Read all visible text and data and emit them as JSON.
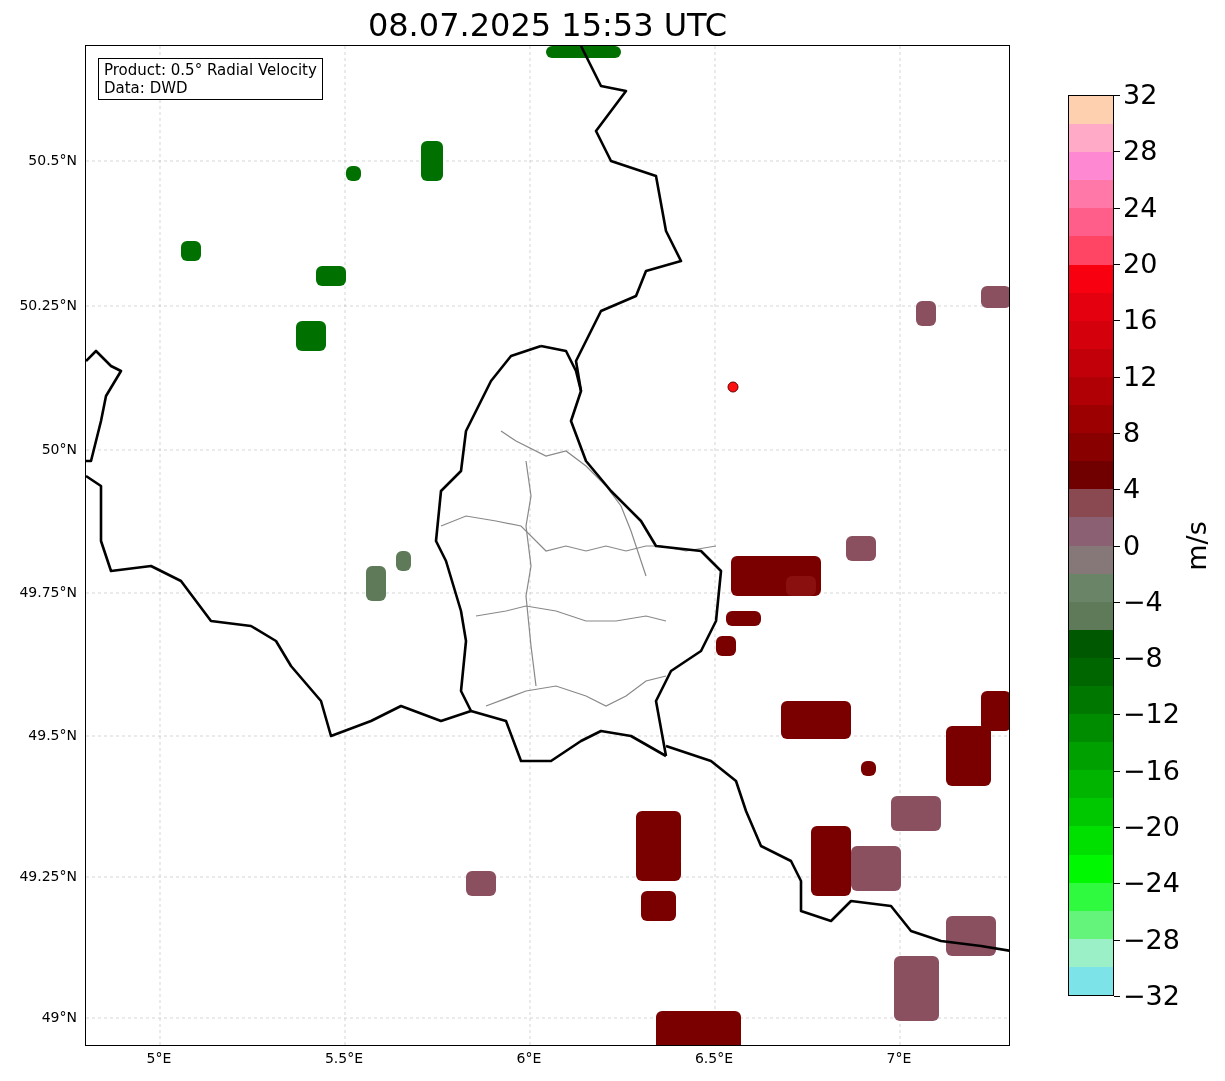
{
  "title": "08.07.2025 15:53 UTC",
  "info_box": {
    "lines": [
      "Product: 0.5° Radial Velocity",
      "Data: DWD"
    ]
  },
  "lat_ticks": [
    "50.5°N",
    "50.25°N",
    "50°N",
    "49.75°N",
    "49.5°N",
    "49.25°N",
    "49°N"
  ],
  "lon_ticks": [
    "5°E",
    "5.5°E",
    "6°E",
    "6.5°E",
    "7°E"
  ],
  "colorbar": {
    "label": "m/s",
    "ticks": [
      "32",
      "28",
      "24",
      "20",
      "16",
      "12",
      "8",
      "4",
      "0",
      "−4",
      "−8",
      "−12",
      "−16",
      "−20",
      "−24",
      "−28",
      "−32"
    ],
    "bins": [
      {
        "color": "#ffd0b0"
      },
      {
        "color": "#ffaac6"
      },
      {
        "color": "#ff88d2"
      },
      {
        "color": "#ff78a8"
      },
      {
        "color": "#ff5e8a"
      },
      {
        "color": "#ff4464"
      },
      {
        "color": "#f80010"
      },
      {
        "color": "#e4000e"
      },
      {
        "color": "#d4000c"
      },
      {
        "color": "#c2000a"
      },
      {
        "color": "#b00006"
      },
      {
        "color": "#9c0000"
      },
      {
        "color": "#880000"
      },
      {
        "color": "#700000"
      },
      {
        "color": "#8a4850"
      },
      {
        "color": "#8a6072"
      },
      {
        "color": "#867878"
      },
      {
        "color": "#6a8468"
      },
      {
        "color": "#5e7a58"
      },
      {
        "color": "#005800"
      },
      {
        "color": "#006600"
      },
      {
        "color": "#007800"
      },
      {
        "color": "#008c00"
      },
      {
        "color": "#00a000"
      },
      {
        "color": "#00b400"
      },
      {
        "color": "#00c800"
      },
      {
        "color": "#00e000"
      },
      {
        "color": "#00f800"
      },
      {
        "color": "#30fa40"
      },
      {
        "color": "#64f47c"
      },
      {
        "color": "#9cf0c8"
      },
      {
        "color": "#7ce4e8"
      }
    ]
  }
}
